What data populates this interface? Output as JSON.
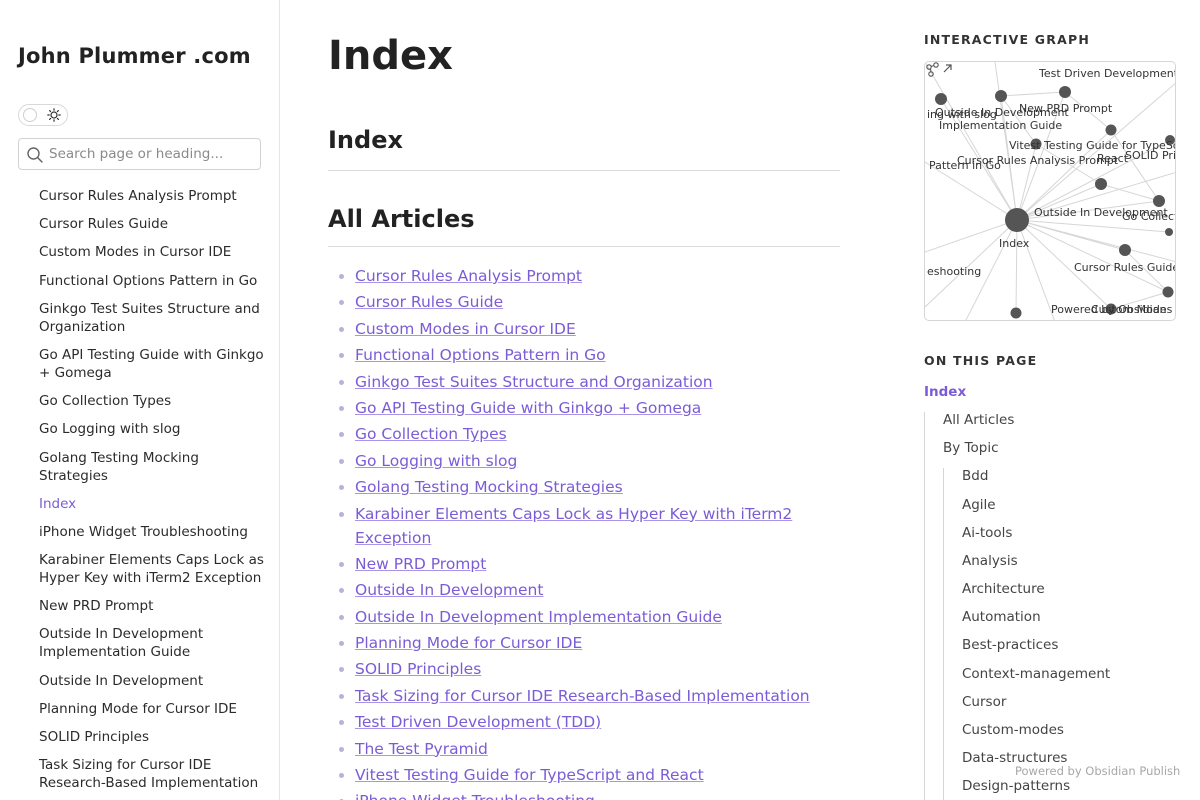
{
  "site": {
    "title": "John Plummer .com"
  },
  "search": {
    "placeholder": "Search page or heading..."
  },
  "sidebar": {
    "items": [
      "Cursor Rules Analysis Prompt",
      "Cursor Rules Guide",
      "Custom Modes in Cursor IDE",
      "Functional Options Pattern in Go",
      "Ginkgo Test Suites Structure and Organization",
      "Go API Testing Guide with Ginkgo + Gomega",
      "Go Collection Types",
      "Go Logging with slog",
      "Golang Testing Mocking Strategies",
      "Index",
      "iPhone Widget Troubleshooting",
      "Karabiner Elements Caps Lock as Hyper Key with iTerm2 Exception",
      "New PRD Prompt",
      "Outside In Development Implementation Guide",
      "Outside In Development",
      "Planning Mode for Cursor IDE",
      "SOLID Principles",
      "Task Sizing for Cursor IDE Research-Based Implementation"
    ],
    "active_index": 9
  },
  "main": {
    "title": "Index",
    "heading_index": "Index",
    "heading_articles": "All Articles",
    "articles": [
      "Cursor Rules Analysis Prompt",
      "Cursor Rules Guide",
      "Custom Modes in Cursor IDE",
      "Functional Options Pattern in Go",
      "Ginkgo Test Suites Structure and Organization",
      "Go API Testing Guide with Ginkgo + Gomega",
      "Go Collection Types",
      "Go Logging with slog",
      "Golang Testing Mocking Strategies",
      "Karabiner Elements Caps Lock as Hyper Key with iTerm2 Exception",
      "New PRD Prompt",
      "Outside In Development",
      "Outside In Development Implementation Guide",
      "Planning Mode for Cursor IDE",
      "SOLID Principles",
      "Task Sizing for Cursor IDE Research-Based Implementation",
      "Test Driven Development (TDD)",
      "The Test Pyramid",
      "Vitest Testing Guide for TypeScript and React",
      "iPhone Widget Troubleshooting"
    ]
  },
  "graph": {
    "heading": "INTERACTIVE GRAPH",
    "labels": [
      "Test Driven Development",
      "New PRD Prompt",
      "Outside In Development",
      "Implementation Guide",
      "ing with slog",
      "Vitest Testing Guide for TypeSc",
      "Cursor Rules Analysis Prompt",
      "React",
      "SOLID Pri",
      "Pattern in Go",
      "Outside In Development",
      "Go Collectio",
      "Index",
      "eshooting",
      "Cursor Rules Guide",
      "Powered by Obsidian",
      "Custom Modes"
    ]
  },
  "toc": {
    "heading": "ON THIS PAGE",
    "items": [
      {
        "label": "Index",
        "level": 0
      },
      {
        "label": "All Articles",
        "level": 1
      },
      {
        "label": "By Topic",
        "level": 1
      },
      {
        "label": "Bdd",
        "level": 2
      },
      {
        "label": "Agile",
        "level": 2
      },
      {
        "label": "Ai-tools",
        "level": 2
      },
      {
        "label": "Analysis",
        "level": 2
      },
      {
        "label": "Architecture",
        "level": 2
      },
      {
        "label": "Automation",
        "level": 2
      },
      {
        "label": "Best-practices",
        "level": 2
      },
      {
        "label": "Context-management",
        "level": 2
      },
      {
        "label": "Cursor",
        "level": 2
      },
      {
        "label": "Custom-modes",
        "level": 2
      },
      {
        "label": "Data-structures",
        "level": 2
      },
      {
        "label": "Design-patterns",
        "level": 2
      }
    ]
  },
  "footer": {
    "text": "Powered by Obsidian Publish"
  },
  "colors": {
    "accent": "#7b5cd6",
    "text": "#222222",
    "muted": "#a7a7a7"
  }
}
